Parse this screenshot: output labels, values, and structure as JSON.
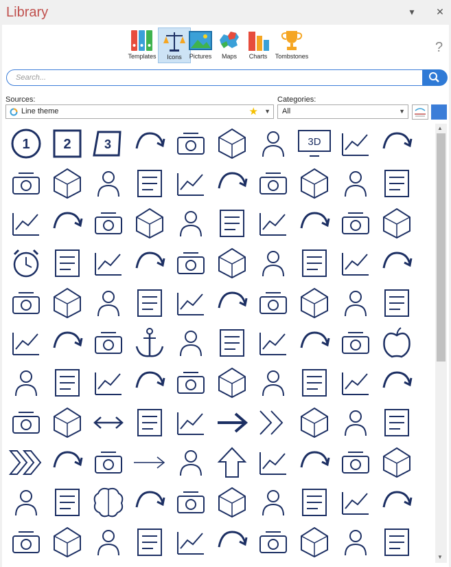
{
  "window": {
    "title": "Library",
    "dropdown_icon": "chevron-down-icon",
    "close_icon": "close-icon"
  },
  "tabs": [
    {
      "label": "Templates",
      "icon": "binders-icon",
      "active": false
    },
    {
      "label": "Icons",
      "icon": "scales-icon",
      "active": true
    },
    {
      "label": "Pictures",
      "icon": "picture-icon",
      "active": false
    },
    {
      "label": "Maps",
      "icon": "map-icon",
      "active": false
    },
    {
      "label": "Charts",
      "icon": "bar-chart-icon",
      "active": false
    },
    {
      "label": "Tombstones",
      "icon": "trophy-icon",
      "active": false
    }
  ],
  "help": {
    "label": "?"
  },
  "search": {
    "placeholder": "Search..."
  },
  "sources": {
    "label": "Sources:",
    "value": "Line theme"
  },
  "categories": {
    "label": "Categories:",
    "value": "All"
  },
  "colors": {
    "accent": "#2f7ad6",
    "icon_stroke": "#1c2f63",
    "title": "#c0504d",
    "swatch": "#3b7dd8"
  },
  "icons": [
    [
      "number-one-circle-icon",
      "number-two-square-icon",
      "number-three-parallelogram-icon",
      "3d-cube-icon",
      "3d-shapes-icon",
      "3d-printer-icon",
      "3d-printer-box-icon",
      "3d-monitor-icon",
      "abacus-icon",
      "user-arrows-icon"
    ],
    [
      "cash-calculator-icon",
      "calculator-icon",
      "land-map-icon",
      "museum-icon",
      "stop-hand-icon",
      "wheat-icon",
      "ai-chip-icon",
      "ai-head-icon",
      "ai-brain-icon",
      "raised-hand-person-icon"
    ],
    [
      "heart-ribbon-icon",
      "awareness-ribbon-icon",
      "air-conditioner-icon",
      "smoke-detector-icon",
      "flight-attendant-icon",
      "airport-road-icon",
      "alarm-signal-icon",
      "siren-light-icon",
      "alarm-bell-icon",
      "siren-icon"
    ],
    [
      "alarm-clock-icon",
      "plant-growth-icon",
      "signpost-arrows-icon",
      "running-person-icon",
      "ambulance-icon",
      "ambulance-side-icon",
      "ambulance-truck-icon",
      "us-heart-flag-icon",
      "us-flag-icon",
      "phone-person-icon"
    ],
    [
      "analytics-person-icon",
      "celebrating-person-icon",
      "chart-board-person-icon",
      "presenter-icon",
      "magnifier-person-icon",
      "chart-magnify-icon",
      "laptop-person-icon",
      "document-search-icon",
      "network-analysis-icon",
      "chart-person-icon"
    ],
    [
      "mobile-search-icon",
      "bar-chart-document-icon",
      "bar-chart-magnify-icon",
      "anchor-icon",
      "hook-anchor-icon",
      "castle-icon",
      "anonymous-mask-icon",
      "satellite-dish-icon",
      "antenna-tower-icon",
      "apple-icon"
    ],
    [
      "aquarium-icon",
      "handshake-scales-icon",
      "arch-icon",
      "triumphal-arch-icon",
      "architect-building-icon",
      "architect-city-icon",
      "engineer-icon",
      "column-icon",
      "area-chart-icon",
      "area-chart-line-icon"
    ],
    [
      "declining-chart-icon",
      "handcuffs-icon",
      "double-arrow-icon",
      "curved-arrow-dotted-icon",
      "curved-arrow-right-icon",
      "arrow-right-icon",
      "double-chevron-icon",
      "outline-arrow-right-icon",
      "arrow-up-right-icon",
      "curved-arrow-down-icon"
    ],
    [
      "double-chevron-outline-icon",
      "arc-arrow-icon",
      "u-turn-arrow-icon",
      "thin-arrow-right-icon",
      "rounded-arrow-right-icon",
      "arrow-up-icon",
      "arc-arrow-down-icon",
      "curve-arrow-dotted-down-icon",
      "swoosh-arrow-icon",
      "curved-arrow-up-icon"
    ],
    [
      "curved-arrow-back-icon",
      "arc-arrow-right-icon",
      "brain-icon",
      "palette-icon",
      "assembly-line-icon",
      "factory-workers-icon",
      "astronaut-icon",
      "astronomer-icon",
      "telescope-person-icon",
      "atm-machine-icon"
    ],
    [
      "atm-card-icon",
      "atom-icon",
      "atom-nucleus-icon",
      "nuclear-explosion-icon",
      "audit-documents-icon",
      "smart-city-icon",
      "mobile-ar-icon",
      "vr-headset-person-icon",
      "robot-arm-icon",
      "robot-arms-icon"
    ]
  ]
}
